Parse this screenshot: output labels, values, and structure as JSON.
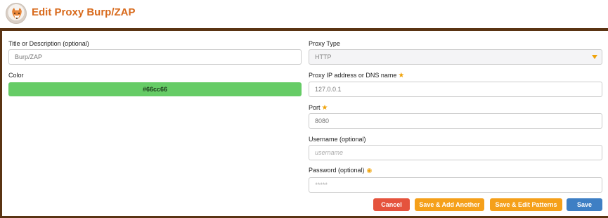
{
  "header": {
    "title": "Edit Proxy Burp/ZAP",
    "logo_icon": "fox-logo-icon"
  },
  "colors": {
    "frame": "#5a3413",
    "title": "#d86a1c",
    "accent": "#f0a30a",
    "color_swatch": "#66cc66",
    "cancel": "#e5533d",
    "save_alt": "#f5a01a",
    "save": "#3e7fc4"
  },
  "form": {
    "title_label": "Title or Description (optional)",
    "title_value": "Burp/ZAP",
    "color_label": "Color",
    "color_value": "#66cc66",
    "proxy_type_label": "Proxy Type",
    "proxy_type_value": "HTTP",
    "ip_label": "Proxy IP address or DNS name",
    "ip_value": "127.0.0.1",
    "port_label": "Port",
    "port_value": "8080",
    "username_label": "Username (optional)",
    "username_placeholder": "username",
    "password_label": "Password (optional)",
    "password_placeholder": "*****"
  },
  "buttons": {
    "cancel": "Cancel",
    "save_add_another": "Save & Add Another",
    "save_edit_patterns": "Save & Edit Patterns",
    "save": "Save"
  }
}
